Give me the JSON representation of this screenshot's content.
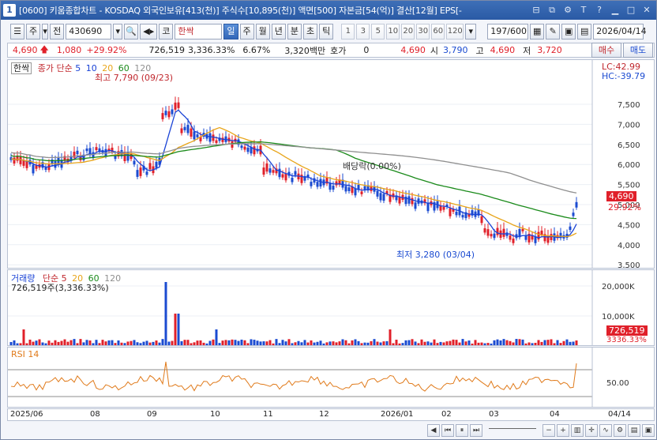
{
  "window": {
    "title": "[0600] 키움종합차트 - KOSDAQ 외국인보유[413(천)] 주식수[10,895(천)] 액면[500] 자본금[54(억)] 결산[12월] EPS[-",
    "app_icon": "1"
  },
  "toolbar": {
    "period_label": "주",
    "prev_label": "전",
    "code": "430690",
    "market_label": "코",
    "stock_name": "한싹",
    "timeframes": [
      "일",
      "주",
      "월",
      "년",
      "분",
      "초",
      "틱"
    ],
    "active_timeframe": "일",
    "minute_steps": [
      "1",
      "3",
      "5",
      "10",
      "20",
      "30",
      "60",
      "120"
    ],
    "count": "197/600",
    "date": "2026/04/14"
  },
  "quote": {
    "price": "4,690",
    "change": "1,080",
    "change_pct": "+29.92%",
    "volume": "726,519",
    "volume_pct": "3,336.33%",
    "turnover": "6.67%",
    "amount": "3,320백만",
    "hoga_label": "호가",
    "hoga_value": "0",
    "ask_price": "4,690",
    "open_label": "시",
    "open": "3,790",
    "high_label": "고",
    "high": "4,690",
    "low_label": "저",
    "low": "3,720",
    "buy_label": "매수",
    "sell_label": "매도"
  },
  "price_panel": {
    "legend_name": "한싹",
    "legend_ma_title": "종가 단순",
    "ma_periods": [
      "5",
      "10",
      "20",
      "60",
      "120"
    ],
    "ma_colors": [
      "#1a43d6",
      "#1a8a1a",
      "#e8a51a",
      "#1a8a1a",
      "#8f8f8f"
    ],
    "lc_label": "LC:42.99",
    "hc_label": "HC:-39.79",
    "high_marker": "최고 7,790 (09/23)",
    "low_marker": "최저 3,280 (03/04)",
    "dividend_marker": "배당락(0.00%)",
    "current_price_tag": "4,690",
    "current_pct_tag": "29.92%",
    "y_ticks": [
      "7,500",
      "7,000",
      "6,500",
      "6,000",
      "5,500",
      "5,000",
      "4,500",
      "4,000",
      "3,500"
    ]
  },
  "volume_panel": {
    "legend_title": "거래량",
    "legend_ma": "단순",
    "ma_periods": [
      "5",
      "20",
      "60",
      "120"
    ],
    "subtitle": "726,519주(3,336.33%)",
    "y_ticks": [
      "20,000K",
      "10,000K"
    ],
    "tag_value": "726,519",
    "tag_pct": "3336.33%"
  },
  "rsi_panel": {
    "legend": "RSI 14",
    "y_tick": "50.00"
  },
  "time_axis": {
    "labels": [
      "2025/06",
      "08",
      "09",
      "10",
      "11",
      "12",
      "2026/01",
      "02",
      "03",
      "04",
      "04/14"
    ]
  },
  "colors": {
    "up": "#e0202a",
    "down": "#1b4bd1",
    "title_bar": "#2a5aa5",
    "rsi_line": "#e07a1a"
  }
}
